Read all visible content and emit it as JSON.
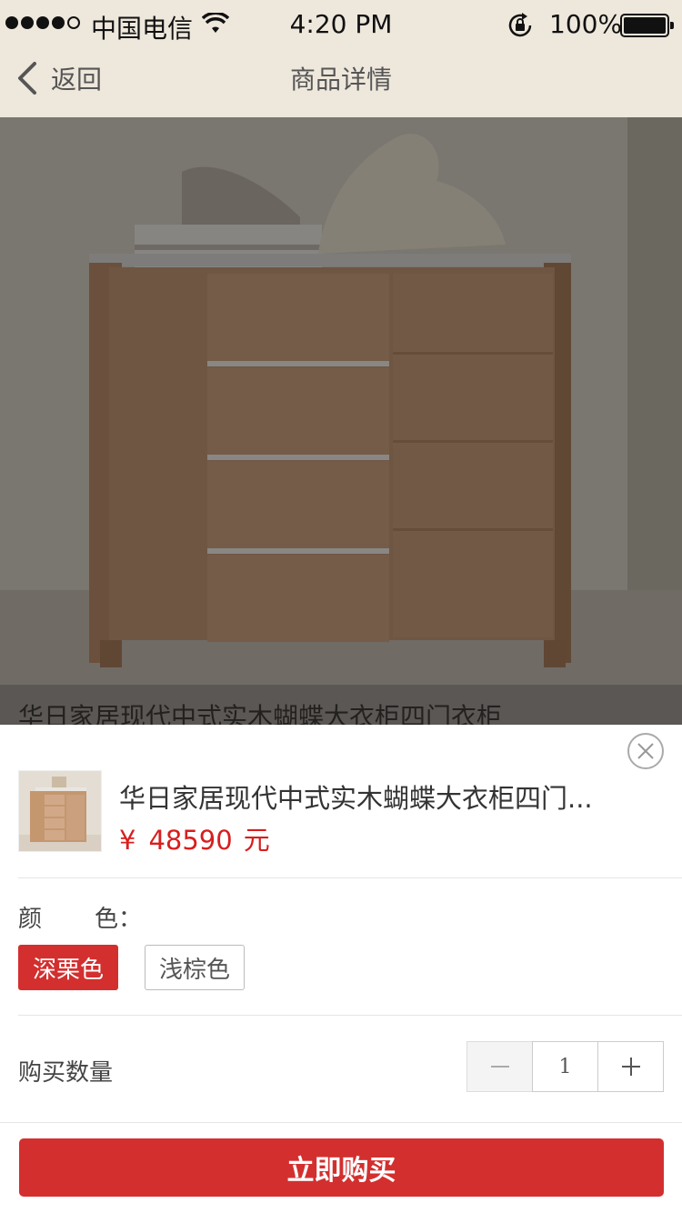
{
  "status_bar": {
    "carrier": "中国电信",
    "time": "4:20 PM",
    "battery": "100%",
    "signal_strength": 4,
    "battery_level": 1.0
  },
  "nav": {
    "back_label": "返回",
    "title": "商品详情"
  },
  "product": {
    "name": "华日家居现代中式实木蝴蝶大衣柜四门衣柜",
    "name_truncated": "华日家居现代中式实木蝴蝶大衣柜四门...",
    "price_symbol": "¥",
    "price": "48590",
    "price_unit": "元"
  },
  "options": {
    "color_label_1": "颜",
    "color_label_2": "色：",
    "colors": [
      "深栗色",
      "浅棕色"
    ],
    "selected_color": "深栗色"
  },
  "quantity": {
    "label": "购买数量",
    "value": "1"
  },
  "actions": {
    "buy_label": "立即购买"
  },
  "colors": {
    "accent": "#d32f2f",
    "nav_bg": "#eee7dc",
    "price": "#d81e1e"
  },
  "icons": [
    "back-chevron-icon",
    "wifi-icon",
    "rotation-lock-icon",
    "battery-icon",
    "close-icon",
    "minus-icon",
    "plus-icon"
  ]
}
